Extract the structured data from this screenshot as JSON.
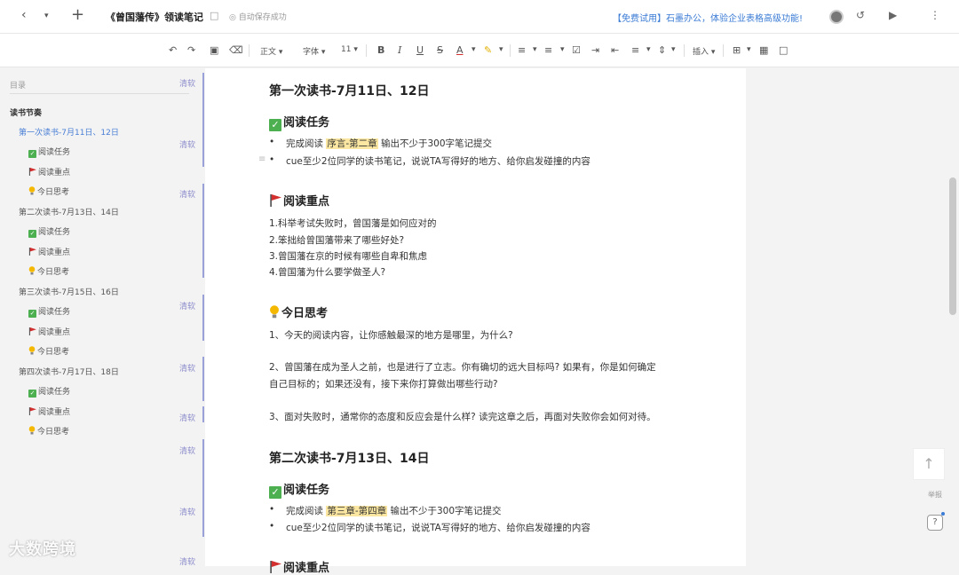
{
  "topbar": {
    "doc_title": "《曾国藩传》领读笔记",
    "save_status": "自动保存成功",
    "promo": "【免费试用】石墨办公，体验企业表格高级功能!"
  },
  "toolbar": {
    "style": "正文",
    "font": "字体",
    "size": "11",
    "insert": "插入"
  },
  "sidebar": {
    "header": "目录",
    "clear": "清软",
    "section": "读书节奏",
    "items": [
      {
        "label": "第一次读书-7月11日、12日",
        "level": 1,
        "active": true
      },
      {
        "label": "阅读任务",
        "level": 2,
        "icon": "check"
      },
      {
        "label": "阅读重点",
        "level": 2,
        "icon": "flag"
      },
      {
        "label": "今日思考",
        "level": 2,
        "icon": "bulb"
      },
      {
        "label": "第二次读书-7月13日、14日",
        "level": 1
      },
      {
        "label": "阅读任务",
        "level": 2,
        "icon": "check"
      },
      {
        "label": "阅读重点",
        "level": 2,
        "icon": "flag"
      },
      {
        "label": "今日思考",
        "level": 2,
        "icon": "bulb"
      },
      {
        "label": "第三次读书-7月15日、16日",
        "level": 1
      },
      {
        "label": "阅读任务",
        "level": 2,
        "icon": "check"
      },
      {
        "label": "阅读重点",
        "level": 2,
        "icon": "flag"
      },
      {
        "label": "今日思考",
        "level": 2,
        "icon": "bulb"
      },
      {
        "label": "第四次读书-7月17日、18日",
        "level": 1
      },
      {
        "label": "阅读任务",
        "level": 2,
        "icon": "check"
      },
      {
        "label": "阅读重点",
        "level": 2,
        "icon": "flag"
      },
      {
        "label": "今日思考",
        "level": 2,
        "icon": "bulb"
      }
    ]
  },
  "doc": {
    "s1_title": "第一次读书-7月11日、12日",
    "task_heading": "阅读任务",
    "s1_task1_pre": "完成阅读",
    "s1_task1_hl": "序言-第二章",
    "s1_task1_post": "输出不少于300字笔记提交",
    "task2": "cue至少2位同学的读书笔记，说说TA写得好的地方、给你启发碰撞的内容",
    "focus_heading": "阅读重点",
    "focus": [
      "1.科举考试失败时，曾国藩是如何应对的",
      "2.笨拙给曾国藩带来了哪些好处?",
      "3.曾国藩在京的时候有哪些自卑和焦虑",
      "4.曾国藩为什么要学做圣人?"
    ],
    "think_heading": "今日思考",
    "think1": "1、今天的阅读内容，让你感触最深的地方是哪里，为什么?",
    "think2a": "2、曾国藩在成为圣人之前，也是进行了立志。你有确切的远大目标吗? 如果有，你是如何确定",
    "think2b": "自己目标的；如果还没有，接下来你打算做出哪些行动?",
    "think3": "3、面对失败时，通常你的态度和反应会是什么样? 读完这章之后，再面对失败你会如何对待。",
    "s2_title": "第二次读书-7月13日、14日",
    "s2_task1_pre": "完成阅读",
    "s2_task1_hl": "第三章-第四章",
    "s2_task1_post": "输出不少于300字笔记提交",
    "s2_focus_partial": "阅读重点"
  },
  "side_actions": {
    "report": "举报",
    "help": "?"
  },
  "watermark": "大数跨境",
  "colors": {
    "accent": "#3a7bd5",
    "highlight": "#fbe7a1",
    "check": "#4caf50",
    "flag": "#d32f2f"
  }
}
